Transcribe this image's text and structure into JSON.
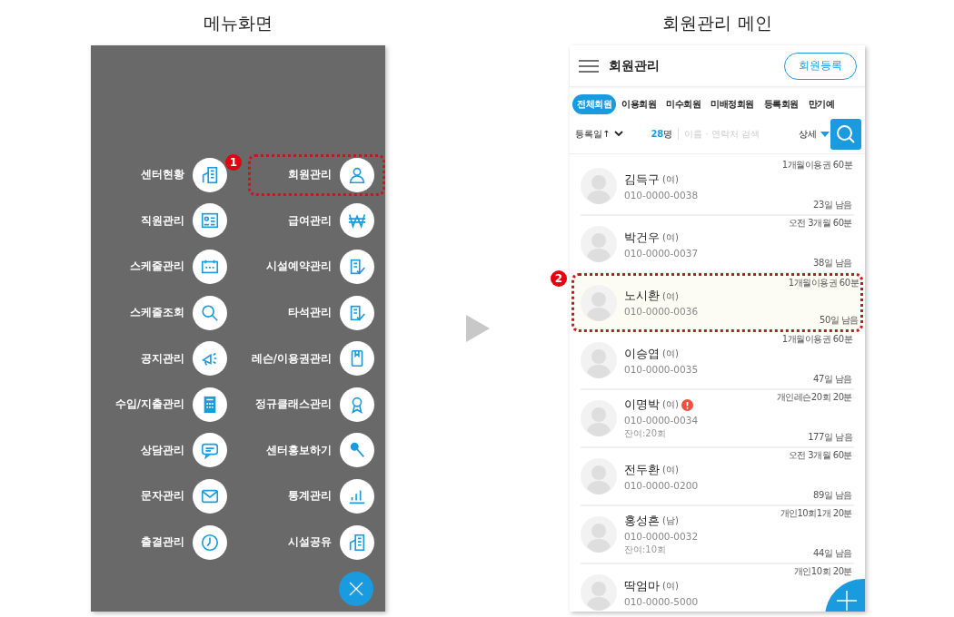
{
  "menu_screen": {
    "caption": "메뉴화면",
    "step_badge": "1",
    "items": [
      {
        "label": "센터현황",
        "selected": false
      },
      {
        "label": "회원관리",
        "selected": true
      },
      {
        "label": "직원관리",
        "selected": false
      },
      {
        "label": "급여관리",
        "selected": false
      },
      {
        "label": "스케줄관리",
        "selected": false
      },
      {
        "label": "시설예약관리",
        "selected": false
      },
      {
        "label": "스케줄조회",
        "selected": false
      },
      {
        "label": "타석관리",
        "selected": false
      },
      {
        "label": "공지관리",
        "selected": false
      },
      {
        "label": "레슨/이용권관리",
        "selected": false
      },
      {
        "label": "수입/지출관리",
        "selected": false
      },
      {
        "label": "정규클래스관리",
        "selected": false
      },
      {
        "label": "상담관리",
        "selected": false
      },
      {
        "label": "센터홍보하기",
        "selected": false
      },
      {
        "label": "문자관리",
        "selected": false
      },
      {
        "label": "통계관리",
        "selected": false
      },
      {
        "label": "출결관리",
        "selected": false
      },
      {
        "label": "시설공유",
        "selected": false
      }
    ]
  },
  "member_screen": {
    "caption": "회원관리 메인",
    "title": "회원관리",
    "register_button": "회원등록",
    "tabs": [
      {
        "label": "전체회원",
        "selected": true
      },
      {
        "label": "이용회원",
        "selected": false
      },
      {
        "label": "미수회원",
        "selected": false
      },
      {
        "label": "미배정회원",
        "selected": false
      },
      {
        "label": "등록회원",
        "selected": false
      },
      {
        "label": "만기예",
        "selected": false
      }
    ],
    "sort": "등록일↑",
    "count": "28",
    "count_unit": "명",
    "search": {
      "placeholder": "이름 · 연락처 검색"
    },
    "detail": "상세",
    "members": [
      {
        "name": "김득구",
        "gender": "(여)",
        "phone": "010-0000-0038",
        "plan": "1개월이용권 60분",
        "days": "23일 남음",
        "alert": false,
        "selected": false
      },
      {
        "name": "박건우",
        "gender": "(여)",
        "phone": "010-0000-0037",
        "plan": "오전 3개월 60분",
        "days": "38일 남음",
        "alert": false,
        "selected": false
      },
      {
        "name": "노시환",
        "gender": "(여)",
        "phone": "010-0000-0036",
        "plan": "1개월이용권 60분",
        "days": "50일 남음",
        "alert": false,
        "selected": true,
        "step": "2"
      },
      {
        "name": "이승엽",
        "gender": "(여)",
        "phone": "010-0000-0035",
        "plan": "1개월이용권 60분",
        "days": "47일 남음",
        "alert": false,
        "selected": false
      },
      {
        "name": "이명박",
        "gender": "(여)",
        "phone": "010-0000-0034",
        "remain": "잔여:20회",
        "plan": "개인레슨20회 20분",
        "days": "177일 남음",
        "alert": true,
        "selected": false
      },
      {
        "name": "전두환",
        "gender": "(여)",
        "phone": "010-0000-0200",
        "plan": "오전 3개월 60분",
        "days": "89일 남음",
        "alert": false,
        "selected": false
      },
      {
        "name": "홍성흔",
        "gender": "(남)",
        "phone": "010-0000-0032",
        "remain": "잔여:10회",
        "plan": "개인10회1개 20분",
        "days": "44일 남음",
        "alert": false,
        "selected": false
      },
      {
        "name": "딱엄마",
        "gender": "(여)",
        "phone": "010-0000-5000",
        "plan": "개인10회 20분",
        "alert": false,
        "selected": false
      }
    ]
  }
}
